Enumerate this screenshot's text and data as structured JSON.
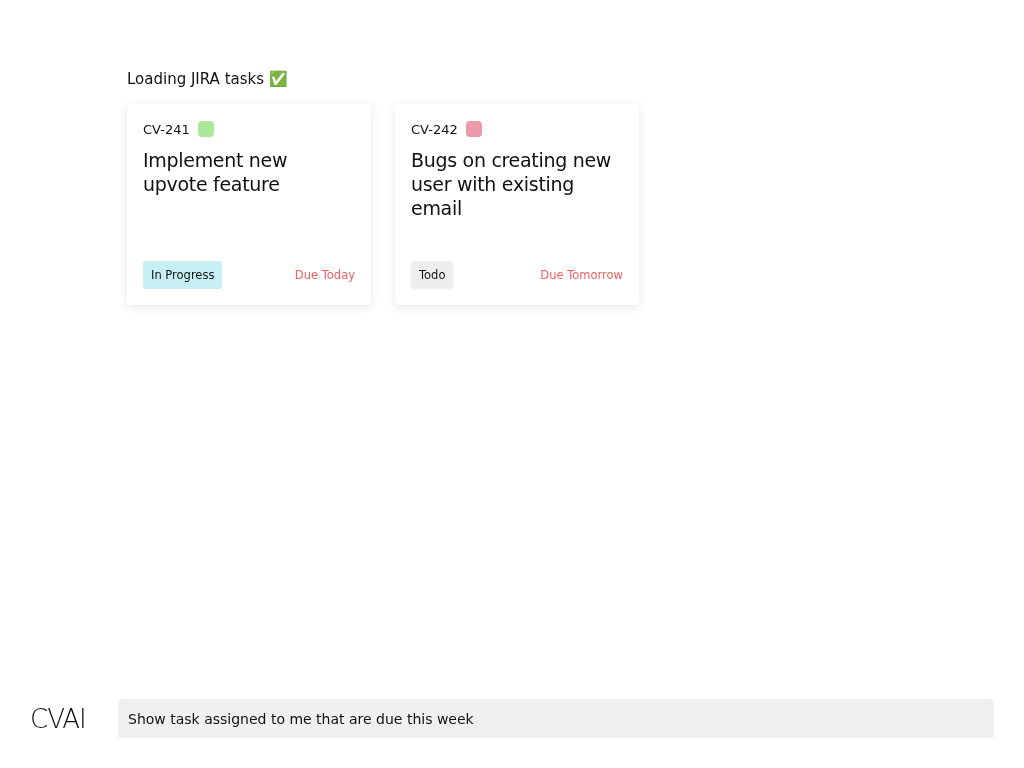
{
  "heading": "Loading JIRA tasks",
  "heading_emoji": "✅",
  "tasks": [
    {
      "key": "CV-241",
      "color": "#abe89a",
      "title": "Implement new upvote feature",
      "status": {
        "kind": "progress",
        "label": "In Progress"
      },
      "due": "Due Today"
    },
    {
      "key": "CV-242",
      "color": "#eb9aaa",
      "title": "Bugs on creating new user with existing email",
      "status": {
        "kind": "todo",
        "label": "Todo"
      },
      "due": "Due Tomorrow"
    }
  ],
  "logo": "CVAI",
  "prompt": {
    "value": "Show task assigned to me that are due this week"
  }
}
